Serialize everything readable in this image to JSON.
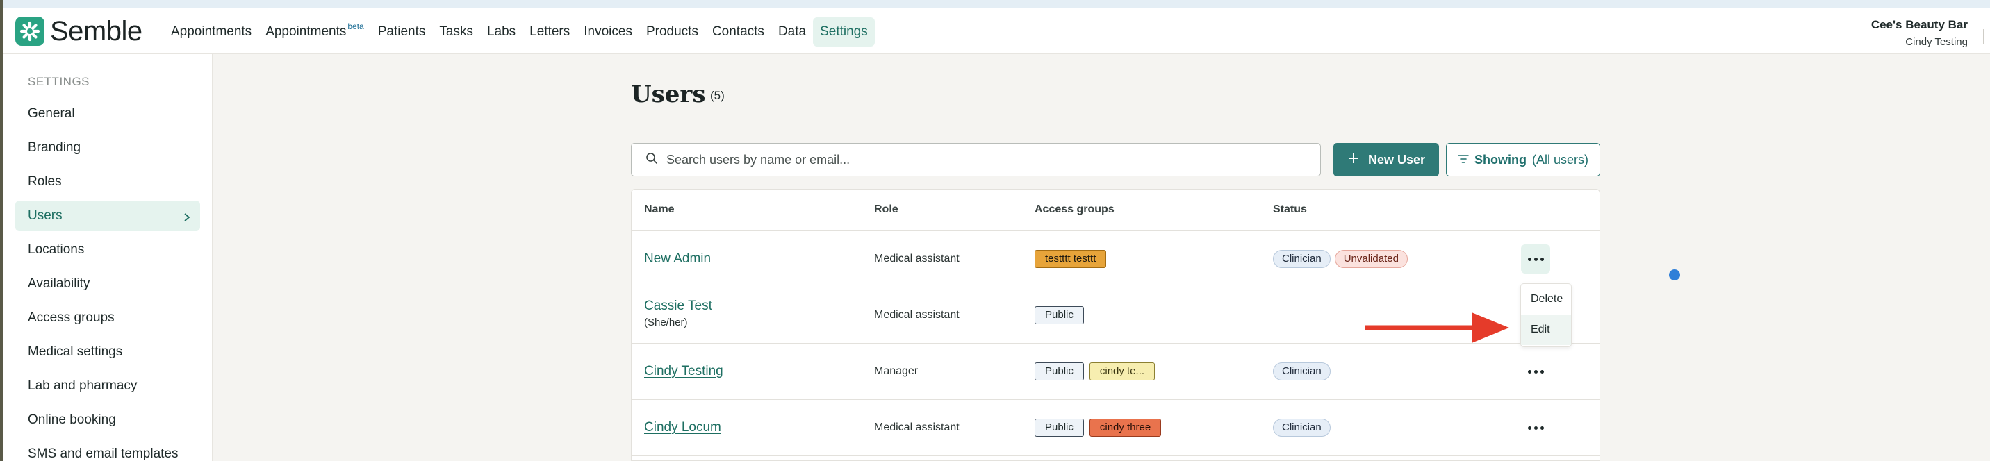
{
  "app": {
    "brand": "Semble",
    "colors": {
      "brand": "#2aa383",
      "accent": "#2f7a77",
      "arrow": "#e53b2a"
    }
  },
  "nav": {
    "items": [
      {
        "label": "Appointments",
        "name": "nav-appointments"
      },
      {
        "label": "Appointments",
        "badge": "beta",
        "name": "nav-appointments-beta"
      },
      {
        "label": "Patients",
        "name": "nav-patients"
      },
      {
        "label": "Tasks",
        "name": "nav-tasks"
      },
      {
        "label": "Labs",
        "name": "nav-labs"
      },
      {
        "label": "Letters",
        "name": "nav-letters"
      },
      {
        "label": "Invoices",
        "name": "nav-invoices"
      },
      {
        "label": "Products",
        "name": "nav-products"
      },
      {
        "label": "Contacts",
        "name": "nav-contacts"
      },
      {
        "label": "Data",
        "name": "nav-data"
      },
      {
        "label": "Settings",
        "name": "nav-settings",
        "active": true
      }
    ],
    "org_name": "Cee's Beauty Bar",
    "org_user": "Cindy Testing"
  },
  "sidebar": {
    "title": "SETTINGS",
    "items": [
      {
        "label": "General"
      },
      {
        "label": "Branding"
      },
      {
        "label": "Roles"
      },
      {
        "label": "Users",
        "active": true
      },
      {
        "label": "Locations"
      },
      {
        "label": "Availability"
      },
      {
        "label": "Access groups"
      },
      {
        "label": "Medical settings"
      },
      {
        "label": "Lab and pharmacy"
      },
      {
        "label": "Online booking"
      },
      {
        "label": "SMS and email templates"
      }
    ]
  },
  "main": {
    "title": "Users",
    "count": "(5)",
    "search_placeholder": "Search users by name or email...",
    "new_user_label": "New User",
    "showing_label": "Showing",
    "showing_value": "(All users)"
  },
  "table": {
    "headers": {
      "name": "Name",
      "role": "Role",
      "access": "Access groups",
      "status": "Status"
    },
    "rows": [
      {
        "name": "New Admin",
        "pronoun": "",
        "role": "Medical assistant",
        "tags": [
          {
            "label": "testttt testtt",
            "style": "orange"
          }
        ],
        "statuses": [
          {
            "label": "Clinician",
            "style": "clin"
          },
          {
            "label": "Unvalidated",
            "style": "unval"
          }
        ],
        "menu_active": true
      },
      {
        "name": "Cassie Test",
        "pronoun": "(She/her)",
        "role": "Medical assistant",
        "tags": [
          {
            "label": "Public",
            "style": "public"
          }
        ],
        "statuses": [],
        "menu_active": false
      },
      {
        "name": "Cindy Testing",
        "pronoun": "",
        "role": "Manager",
        "tags": [
          {
            "label": "Public",
            "style": "public"
          },
          {
            "label": "cindy te...",
            "style": "yellow"
          }
        ],
        "statuses": [
          {
            "label": "Clinician",
            "style": "clin"
          }
        ],
        "menu_active": false
      },
      {
        "name": "Cindy Locum",
        "pronoun": "",
        "role": "Medical assistant",
        "tags": [
          {
            "label": "Public",
            "style": "public"
          },
          {
            "label": "cindy three",
            "style": "red"
          }
        ],
        "statuses": [
          {
            "label": "Clinician",
            "style": "clin"
          }
        ],
        "menu_active": false
      }
    ]
  },
  "row_menu": {
    "delete_label": "Delete",
    "edit_label": "Edit"
  }
}
